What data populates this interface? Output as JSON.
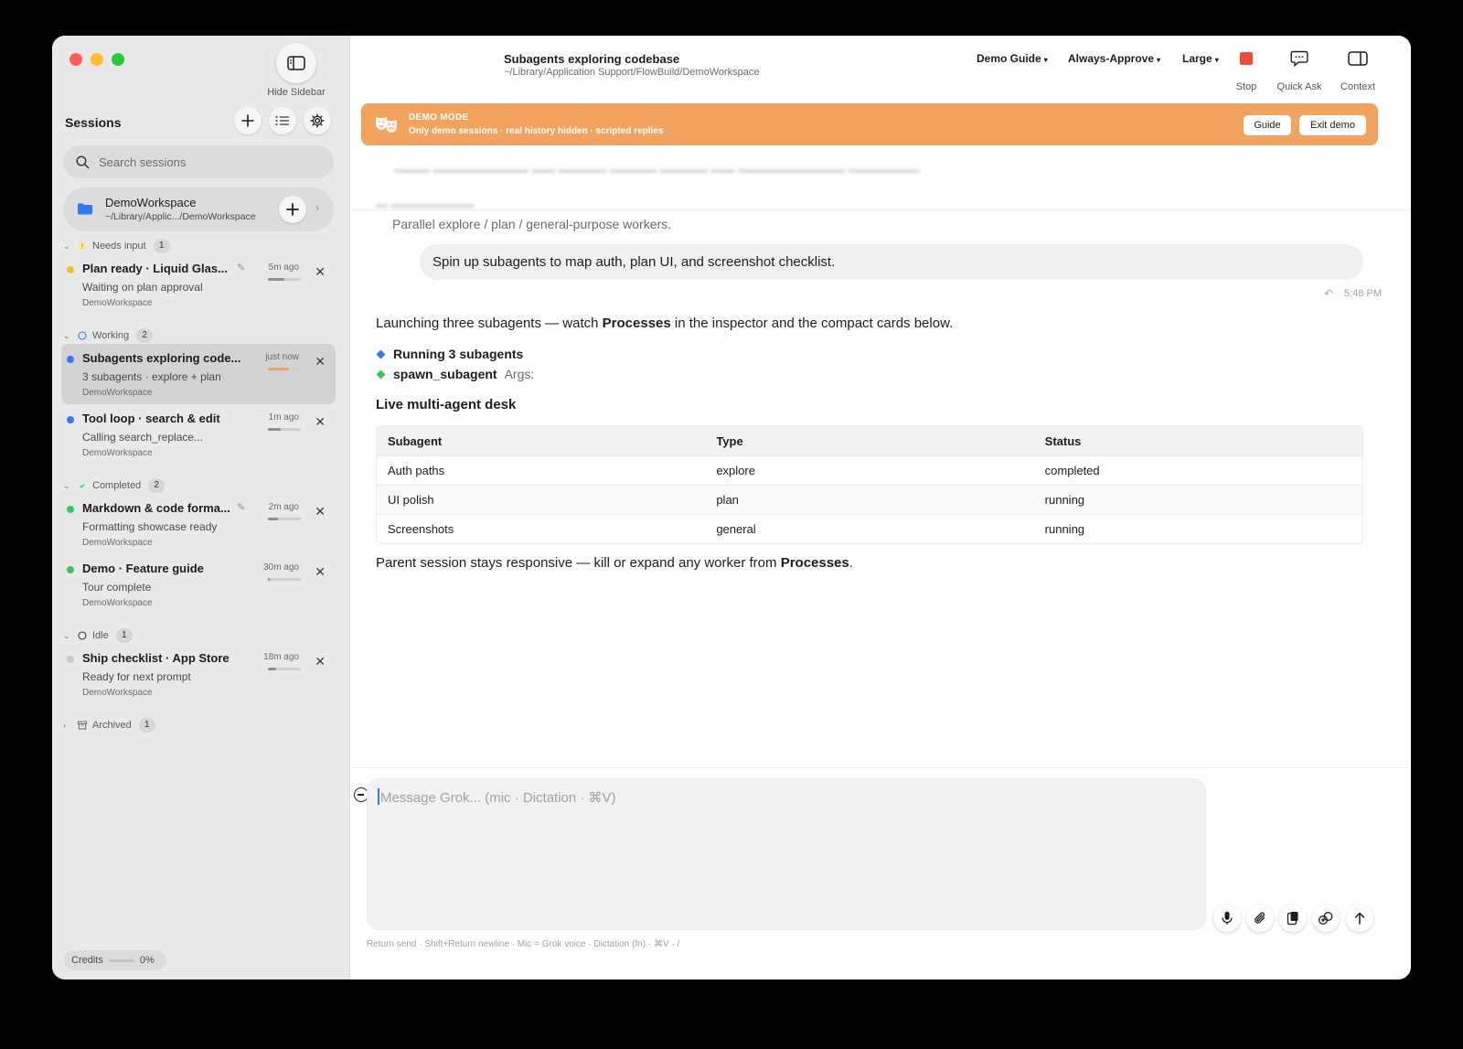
{
  "window": {
    "hide_sidebar_label": "Hide Sidebar"
  },
  "sidebar": {
    "title": "Sessions",
    "search_placeholder": "Search sessions",
    "workspace": {
      "name": "DemoWorkspace",
      "path": "~/Library/Applic.../DemoWorkspace"
    },
    "groups": {
      "needs_input": {
        "label": "Needs input",
        "count": "1"
      },
      "working": {
        "label": "Working",
        "count": "2"
      },
      "completed": {
        "label": "Completed",
        "count": "2"
      },
      "idle": {
        "label": "Idle",
        "count": "1"
      },
      "archived": {
        "label": "Archived",
        "count": "1"
      }
    },
    "sessions": [
      {
        "title": "Plan ready · Liquid Glas...",
        "subtitle": "Waiting on plan approval",
        "workspace": "DemoWorkspace",
        "time": "5m ago",
        "status_color": "#f5c026",
        "pinned": true,
        "progress": 0.5
      },
      {
        "title": "Subagents exploring code...",
        "subtitle": "3 subagents · explore + plan",
        "workspace": "DemoWorkspace",
        "time": "just now",
        "status_color": "#3478f6",
        "pinned": false,
        "progress": 0.65,
        "progress_color": "#f0a35e"
      },
      {
        "title": "Tool loop · search & edit",
        "subtitle": "Calling search_replace...",
        "workspace": "DemoWorkspace",
        "time": "1m ago",
        "status_color": "#3478f6",
        "pinned": false,
        "progress": 0.4
      },
      {
        "title": "Markdown & code forma...",
        "subtitle": "Formatting showcase ready",
        "workspace": "DemoWorkspace",
        "time": "2m ago",
        "status_color": "#34c759",
        "pinned": true,
        "progress": 0.3
      },
      {
        "title": "Demo · Feature guide",
        "subtitle": "Tour complete",
        "workspace": "DemoWorkspace",
        "time": "30m ago",
        "status_color": "#34c759",
        "pinned": false,
        "progress": 0.05
      },
      {
        "title": "Ship checklist · App Store",
        "subtitle": "Ready for next prompt",
        "workspace": "DemoWorkspace",
        "time": "18m ago",
        "status_color": "#c7c7cc",
        "pinned": false,
        "progress": 0.25
      }
    ],
    "credits": {
      "label": "Credits",
      "value": "0%"
    }
  },
  "header": {
    "title": "Subagents exploring codebase",
    "path": "~/Library/Application Support/FlowBuild/DemoWorkspace",
    "dropdowns": {
      "guide": "Demo Guide",
      "approval": "Always-Approve",
      "size": "Large"
    },
    "tools": {
      "stop": "Stop",
      "quick_ask": "Quick Ask",
      "context": "Context"
    }
  },
  "banner": {
    "title": "DEMO MODE",
    "subtitle": "Only demo sessions · real history hidden · scripted replies",
    "guide_button": "Guide",
    "exit_button": "Exit demo"
  },
  "chat": {
    "parallel_text": "Parallel explore / plan / general-purpose workers.",
    "user_message": "Spin up subagents to map auth, plan UI, and screenshot checklist.",
    "user_time": "5:48 PM",
    "assistant_intro_a": "Launching three subagents — watch ",
    "assistant_intro_bold": "Processes",
    "assistant_intro_b": " in the inspector and the compact cards below.",
    "bullets": [
      {
        "text": "Running 3 subagents",
        "color": "#3478f6"
      },
      {
        "text": "spawn_subagent",
        "extra": "Args:",
        "color": "#34c759"
      }
    ],
    "desk_title": "Live multi-agent desk",
    "table": {
      "headers": [
        "Subagent",
        "Type",
        "Status"
      ],
      "rows": [
        [
          "Auth paths",
          "explore",
          "completed"
        ],
        [
          "UI polish",
          "plan",
          "running"
        ],
        [
          "Screenshots",
          "general",
          "running"
        ]
      ]
    },
    "parent_note_a": "Parent session stays responsive — kill or expand any worker from ",
    "parent_note_bold": "Processes",
    "parent_note_b": "."
  },
  "composer": {
    "placeholder": "Message Grok...  (mic · Dictation · ⌘V)",
    "hints": "Return send  ·  Shift+Return newline  ·  Mic = Grok voice  ·  Dictation (fn)  ·  ⌘V  ·  /"
  }
}
